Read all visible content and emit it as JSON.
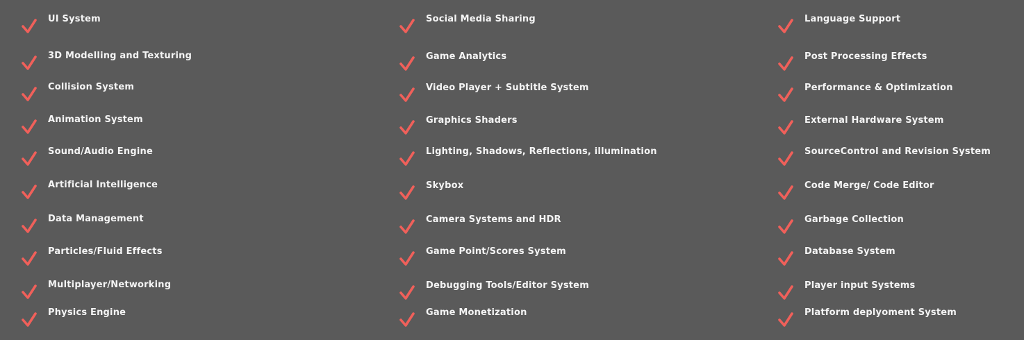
{
  "colors": {
    "background": "#5a5a5a",
    "check": "#f0605a",
    "text": "#f4f4f4"
  },
  "check_icon": "check-icon",
  "columns": [
    {
      "items": [
        "UI System",
        "3D Modelling and Texturing",
        "Collision System",
        "Animation System",
        "Sound/Audio Engine",
        "Artificial Intelligence",
        "Data Management",
        "Particles/Fluid Effects",
        "Multiplayer/Networking",
        "Physics Engine"
      ]
    },
    {
      "items": [
        "Social Media Sharing",
        "Game Analytics",
        "Video Player + Subtitle System",
        "Graphics Shaders",
        "Lighting, Shadows, Reflections, illumination",
        "Skybox",
        "Camera Systems and HDR",
        "Game Point/Scores System",
        "Debugging Tools/Editor System",
        "Game Monetization"
      ]
    },
    {
      "items": [
        "Language Support",
        "Post Processing Effects",
        "Performance & Optimization",
        "External Hardware System",
        "SourceControl and Revision System",
        "Code Merge/ Code Editor",
        "Garbage Collection",
        "Database System",
        "Player input Systems",
        "Platform deplyoment System"
      ]
    }
  ]
}
